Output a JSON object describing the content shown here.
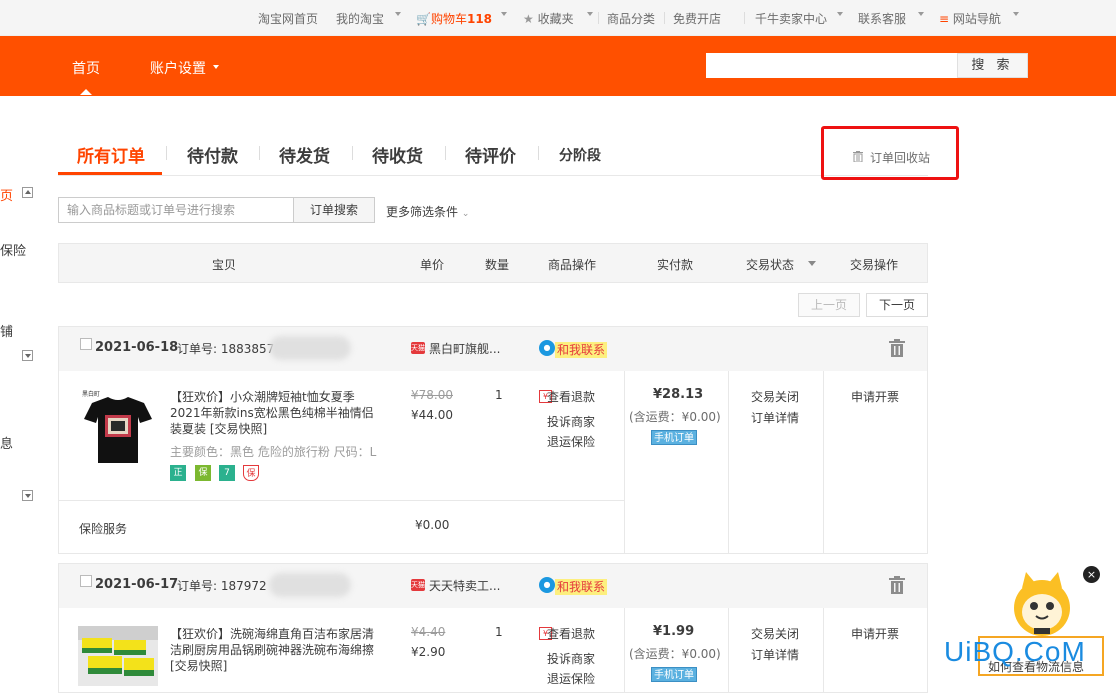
{
  "topbar": {
    "home": "淘宝网首页",
    "my_taobao": "我的淘宝",
    "cart_label": "购物车",
    "cart_count": "118",
    "favorites": "收藏夹",
    "categories": "商品分类",
    "open_shop": "免费开店",
    "seller_center": "千牛卖家中心",
    "customer_service": "联系客服",
    "site_nav": "网站导航"
  },
  "header": {
    "nav_home": "首页",
    "nav_account": "账户设置",
    "search_button": "搜 索",
    "search_value": ""
  },
  "sidebar": {
    "items": [
      "页",
      "保险",
      "铺",
      "息"
    ]
  },
  "tabs": {
    "all": "所有订单",
    "to_pay": "待付款",
    "to_ship": "待发货",
    "to_receive": "待收货",
    "to_review": "待评价",
    "installment": "分阶段",
    "recycle": "订单回收站"
  },
  "filter": {
    "placeholder": "输入商品标题或订单号进行搜索",
    "search_button": "订单搜索",
    "more": "更多筛选条件"
  },
  "table_header": {
    "product": "宝贝",
    "unit_price": "单价",
    "quantity": "数量",
    "product_ops": "商品操作",
    "paid": "实付款",
    "trade_status": "交易状态",
    "trade_ops": "交易操作"
  },
  "pager": {
    "prev": "上一页",
    "next": "下一页"
  },
  "orders": [
    {
      "date": "2021-06-18",
      "order_no_label": "订单号: 1883857",
      "shop": "黑白町旗舰...",
      "shop_badge": "天猫",
      "contact": "和我联系",
      "title": "【狂欢价】小众潮牌短袖t恤女夏季2021年新款ins宽松黑色纯棉半袖情侣装夏装 [交易快照]",
      "attrs": "主要颜色：黑色 危险的旅行粉  尺码：L",
      "original_price": "¥78.00",
      "price": "¥44.00",
      "quantity": "1",
      "op_refund": "查看退款",
      "op_complain": "投诉商家",
      "op_return_ship": "退运保险",
      "paid": "¥28.13",
      "shipping": "(含运费：¥0.00)",
      "mobile": "手机订单",
      "status": "交易关闭",
      "detail": "订单详情",
      "action": "申请开票",
      "insurance_label": "保险服务",
      "insurance_price": "¥0.00",
      "badges": [
        "正",
        "保",
        "7",
        "保"
      ]
    },
    {
      "date": "2021-06-17",
      "order_no_label": "订单号: 187972",
      "shop": "天天特卖工...",
      "shop_badge": "天猫",
      "contact": "和我联系",
      "title": "【狂欢价】洗碗海绵直角百洁布家居清洁刷厨房用品锅刷碗神器洗碗布海绵擦 [交易快照]",
      "original_price": "¥4.40",
      "price": "¥2.90",
      "quantity": "1",
      "op_refund": "查看退款",
      "op_complain": "投诉商家",
      "op_return_ship": "退运保险",
      "paid": "¥1.99",
      "shipping": "(含运费：¥0.00)",
      "mobile": "手机订单",
      "status": "交易关闭",
      "detail": "订单详情",
      "action": "申请开票"
    }
  ],
  "helper": {
    "close": "×",
    "tip": "如何查看物流信息"
  },
  "watermark": "UiBQ.CoM",
  "colors": {
    "brand": "#ff5000",
    "accent": "#ff4400",
    "highlight_box": "#ee1111"
  }
}
